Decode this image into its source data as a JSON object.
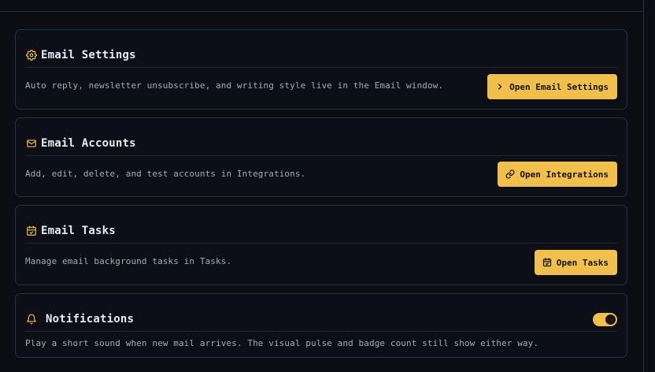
{
  "colors": {
    "accent": "#f0bf4c",
    "background": "#0b0d12",
    "card_border": "#2a2f3a",
    "text_primary": "#e8eaf0",
    "text_secondary": "#a6abb6"
  },
  "sections": {
    "email_settings": {
      "icon": "gear-icon",
      "title": "Email Settings",
      "description": "Auto reply, newsletter unsubscribe, and writing style live in the Email window.",
      "button_icon": "chevron-right-icon",
      "button_label": "Open Email Settings"
    },
    "email_accounts": {
      "icon": "mail-icon",
      "title": "Email Accounts",
      "description": "Add, edit, delete, and test accounts in Integrations.",
      "button_icon": "link-icon",
      "button_label": "Open Integrations"
    },
    "email_tasks": {
      "icon": "calendar-check-icon",
      "title": "Email Tasks",
      "description": "Manage email background tasks in Tasks.",
      "button_icon": "calendar-check-icon",
      "button_label": "Open Tasks"
    },
    "notifications": {
      "icon": "bell-icon",
      "title": "Notifications",
      "description": "Play a short sound when new mail arrives. The visual pulse and badge count still show either way.",
      "toggle_on": true
    }
  }
}
